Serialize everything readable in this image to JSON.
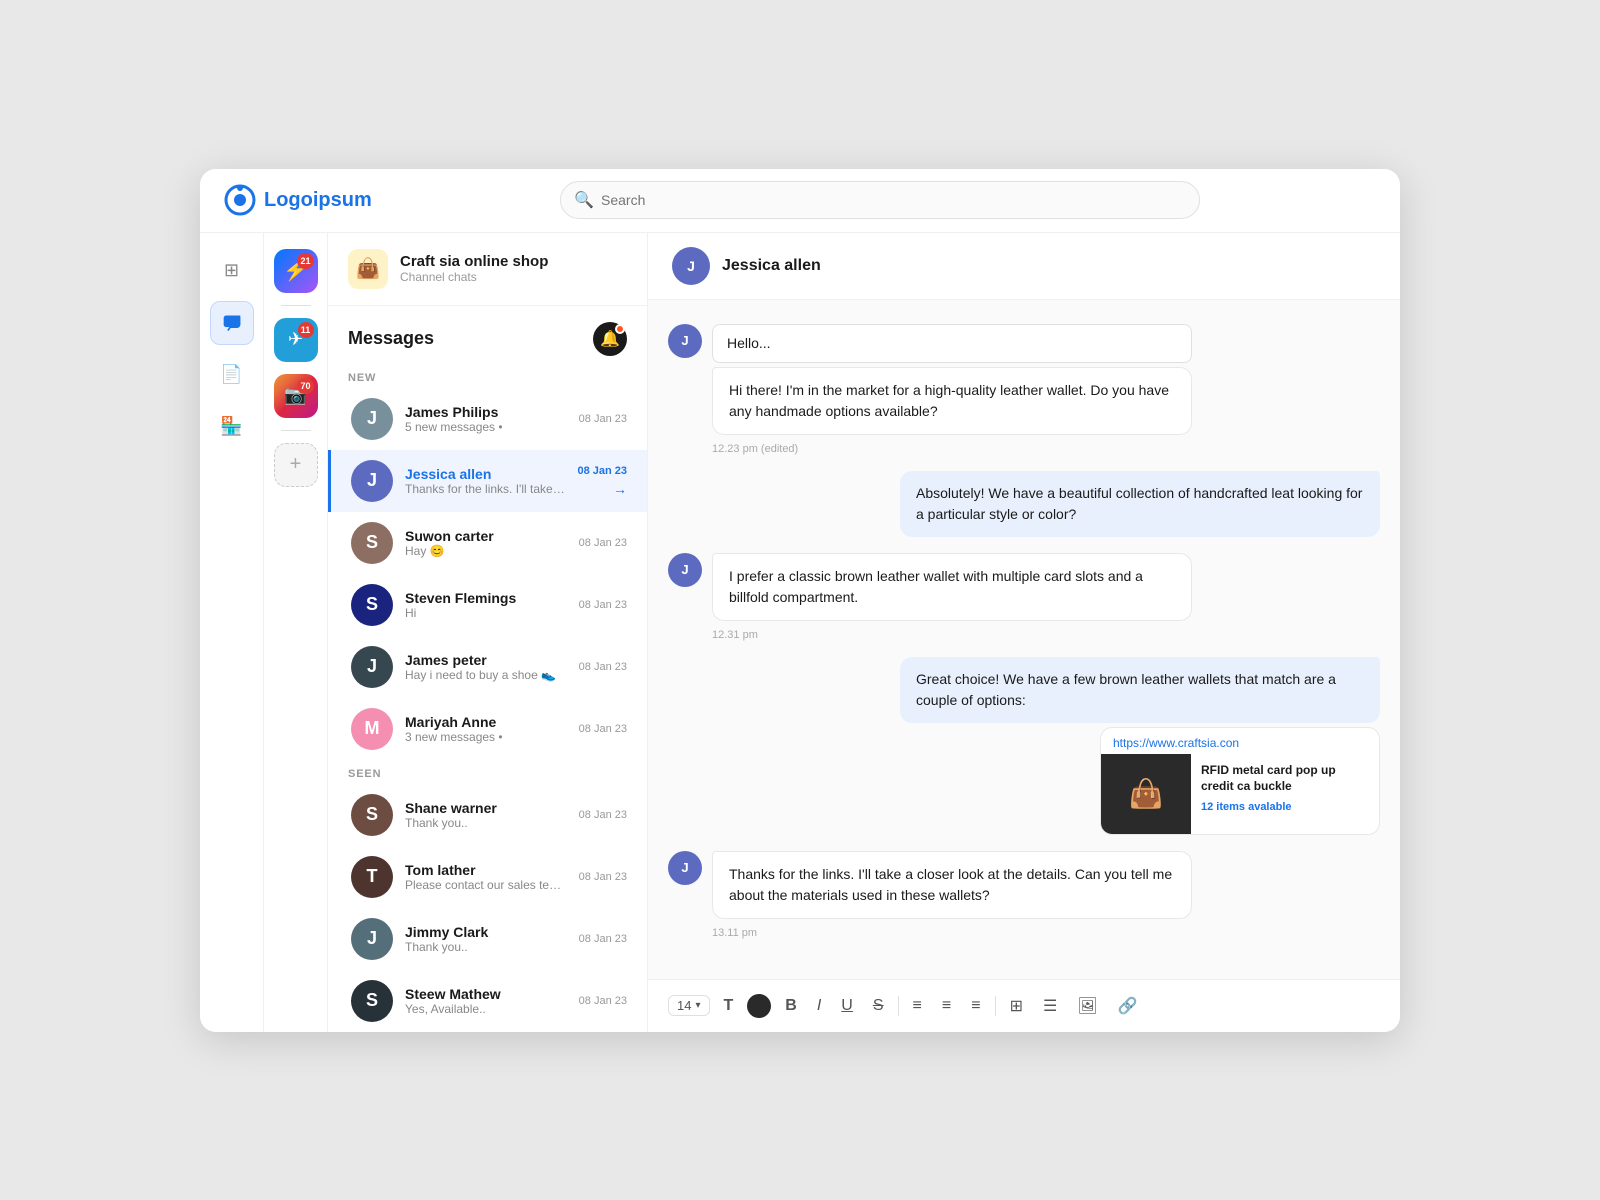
{
  "header": {
    "logo_text": "Logoipsum",
    "search_placeholder": "Search"
  },
  "left_nav": {
    "icons": [
      {
        "name": "grid-icon",
        "symbol": "⊞",
        "active": false
      },
      {
        "name": "chat-icon",
        "symbol": "💬",
        "active": true
      },
      {
        "name": "document-icon",
        "symbol": "📄",
        "active": false
      },
      {
        "name": "store-icon",
        "symbol": "🏪",
        "active": false
      }
    ]
  },
  "social_nav": {
    "platforms": [
      {
        "name": "messenger-icon",
        "symbol": "💬",
        "class": "messenger",
        "badge": "21"
      },
      {
        "name": "telegram-icon",
        "symbol": "✈",
        "class": "telegram",
        "badge": "11"
      },
      {
        "name": "instagram-icon",
        "symbol": "📷",
        "class": "instagram",
        "badge": "70"
      },
      {
        "name": "add-icon",
        "symbol": "+",
        "class": "add"
      }
    ]
  },
  "channel": {
    "icon": "👜",
    "name": "Craft sia online shop",
    "sub": "Channel chats"
  },
  "messages": {
    "title": "Messages",
    "section_new": "NEW",
    "section_seen": "SEEN",
    "new_chats": [
      {
        "id": "james-philips",
        "name": "James Philips",
        "preview": "5 new messages •",
        "time": "08 Jan 23",
        "av_class": "av-james",
        "av_letter": "J"
      },
      {
        "id": "jessica-allen",
        "name": "Jessica allen",
        "preview": "Thanks for the links. I'll take a...",
        "time": "08 Jan 23",
        "active": true,
        "av_class": "av-jessica",
        "av_letter": "J"
      },
      {
        "id": "suwon-carter",
        "name": "Suwon carter",
        "preview": "Hay 😊",
        "time": "08 Jan 23",
        "av_class": "av-suwon",
        "av_letter": "S"
      },
      {
        "id": "steven-flemings",
        "name": "Steven Flemings",
        "preview": "Hi",
        "time": "08 Jan 23",
        "av_class": "av-steven",
        "av_letter": "S"
      },
      {
        "id": "james-peter",
        "name": "James peter",
        "preview": "Hay i need to buy a shoe 👟",
        "time": "08 Jan 23",
        "av_class": "av-jamesp",
        "av_letter": "J"
      },
      {
        "id": "mariyah-anne",
        "name": "Mariyah Anne",
        "preview": "3 new messages •",
        "time": "08 Jan 23",
        "av_class": "av-mariyah",
        "av_letter": "M"
      }
    ],
    "seen_chats": [
      {
        "id": "shane-warner",
        "name": "Shane warner",
        "preview": "Thank you..",
        "time": "08 Jan 23",
        "av_class": "av-shane",
        "av_letter": "S"
      },
      {
        "id": "tom-lather",
        "name": "Tom lather",
        "preview": "Please contact our sales team..",
        "time": "08 Jan 23",
        "av_class": "av-tom",
        "av_letter": "T"
      },
      {
        "id": "jimmy-clark",
        "name": "Jimmy Clark",
        "preview": "Thank you..",
        "time": "08 Jan 23",
        "av_class": "av-jimmy",
        "av_letter": "J"
      },
      {
        "id": "steew-mathew",
        "name": "Steew Mathew",
        "preview": "Yes, Available..",
        "time": "08 Jan 23",
        "av_class": "av-steew",
        "av_letter": "S"
      }
    ]
  },
  "chat": {
    "contact_name": "Jessica allen",
    "messages": [
      {
        "id": "msg1",
        "type": "incoming",
        "greeting": "Hello...",
        "body": "Hi there! I'm in the market for a high-quality leather wallet. Do you have any handmade options available?",
        "time": "12.23 pm (edited)"
      },
      {
        "id": "msg2",
        "type": "outgoing",
        "body": "Absolutely! We have a beautiful collection of handcrafted leat looking for a particular style or color?",
        "time": ""
      },
      {
        "id": "msg3",
        "type": "incoming",
        "body": "I prefer a classic brown leather wallet with multiple card slots and a billfold compartment.",
        "time": "12.31 pm"
      },
      {
        "id": "msg4",
        "type": "outgoing",
        "body": "Great choice! We have a few brown leather wallets that match are a couple of options:",
        "product_link": "https://www.craftsia.con",
        "product_title": "RFID metal card pop up credit ca buckle",
        "product_available": "12 items avalable",
        "time": ""
      },
      {
        "id": "msg5",
        "type": "incoming",
        "body": "Thanks for the links. I'll take a closer look at the details. Can you tell me about the materials used in these wallets?",
        "time": "13.11 pm"
      }
    ]
  },
  "toolbar": {
    "font_size": "14",
    "buttons": [
      "T",
      "B",
      "I",
      "U",
      "S",
      "≡",
      "≡",
      "≡",
      "⊞",
      "≡",
      "🖼",
      "🔗"
    ]
  }
}
